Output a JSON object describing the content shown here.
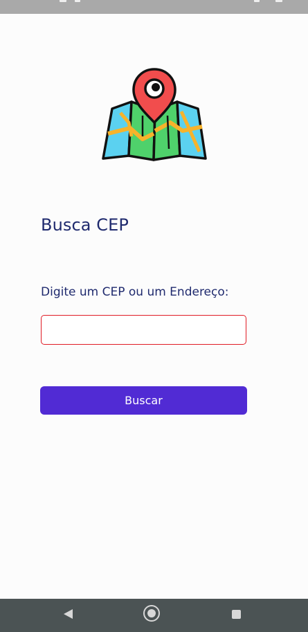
{
  "app": {
    "title": "Busca CEP"
  },
  "logo": {
    "icon": "map-pin-icon"
  },
  "form": {
    "label": "Digite um CEP ou um Endereço:",
    "input_value": "",
    "input_border_color": "#e01b24",
    "button_label": "Buscar",
    "button_color": "#512bd4"
  },
  "system": {
    "status_bar_color": "#a9a9a9",
    "nav_bar_color": "#4b5354",
    "nav_icons": [
      "back-icon",
      "home-icon",
      "recents-icon"
    ]
  }
}
